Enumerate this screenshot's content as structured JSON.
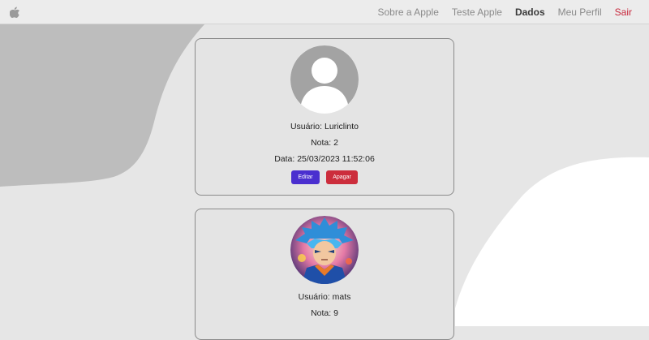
{
  "navbar": {
    "logo_icon": "apple-icon",
    "links": [
      {
        "label": "Sobre a Apple"
      },
      {
        "label": "Teste Apple"
      },
      {
        "label": "Dados"
      },
      {
        "label": "Meu Perfil"
      },
      {
        "label": "Sair"
      }
    ],
    "active_index": 2,
    "danger_color": "#c8283c"
  },
  "cards": [
    {
      "avatar": "default-user-avatar-icon",
      "usuario": "Usuário: Luriclinto",
      "nota": "Nota: 2",
      "data": "Data: 25/03/2023 11:52:06",
      "edit_label": "Editar",
      "delete_label": "Apagar"
    },
    {
      "avatar": "anime-character-avatar",
      "usuario": "Usuário: mats",
      "nota": "Nota: 9"
    }
  ],
  "colors": {
    "edit_button": "#4a2fcf",
    "delete_button": "#cc2d3c",
    "background": "#e6e6e6"
  }
}
